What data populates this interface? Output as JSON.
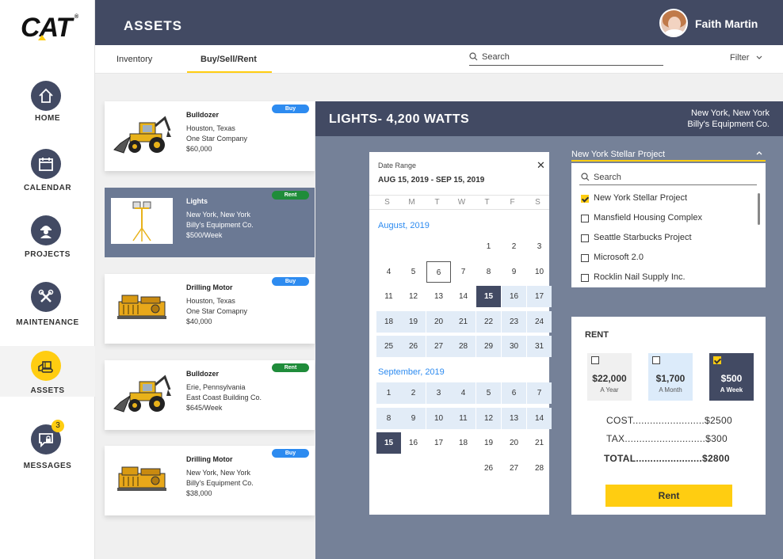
{
  "brand": {
    "logo": "CAT",
    "registered": "®",
    "accent": "#ffcd11",
    "dark": "#424a63",
    "slate": "#758198"
  },
  "header": {
    "title": "ASSETS",
    "user_name": "Faith Martin"
  },
  "sidebar": {
    "items": [
      {
        "label": "HOME",
        "icon": "home-icon"
      },
      {
        "label": "CALENDAR",
        "icon": "calendar-icon"
      },
      {
        "label": "PROJECTS",
        "icon": "worker-icon"
      },
      {
        "label": "MAINTENANCE",
        "icon": "tools-icon"
      },
      {
        "label": "ASSETS",
        "icon": "excavator-icon",
        "active": true
      },
      {
        "label": "MESSAGES",
        "icon": "message-icon",
        "badge": "3"
      }
    ]
  },
  "tabs": {
    "items": [
      "Inventory",
      "Buy/Sell/Rent"
    ],
    "active": "Buy/Sell/Rent"
  },
  "search": {
    "placeholder": "Search"
  },
  "filter": {
    "label": "Filter"
  },
  "assets": [
    {
      "name": "Bulldozer",
      "location": "Houston, Texas",
      "company": "One Star Company",
      "price": "$60,000",
      "tag": "Buy",
      "image": "backhoe"
    },
    {
      "name": "Lights",
      "location": "New York, New York",
      "company": "Billy's Equipment Co.",
      "price": "$500/Week",
      "tag": "Rent",
      "image": "lights",
      "selected": true
    },
    {
      "name": "Drilling Motor",
      "location": "Houston, Texas",
      "company": "One Star Comapny",
      "price": "$40,000",
      "tag": "Buy",
      "image": "generator"
    },
    {
      "name": "Bulldozer",
      "location": "Erie, Pennsylvania",
      "company": "East Coast Building Co.",
      "price": "$645/Week",
      "tag": "Rent",
      "image": "backhoe"
    },
    {
      "name": "Drilling Motor",
      "location": "New York, New York",
      "company": "Billy's Equipment Co.",
      "price": "$38,000",
      "tag": "Buy",
      "image": "generator"
    }
  ],
  "detail": {
    "title": "LIGHTS- 4,200 WATTS",
    "location": "New York, New York",
    "company": "Billy's Equipment Co."
  },
  "calendar": {
    "label": "Date Range",
    "range": "AUG 15, 2019 - SEP 15, 2019",
    "weekdays": [
      "S",
      "M",
      "T",
      "W",
      "T",
      "F",
      "S"
    ],
    "months": [
      {
        "name": "August, 2019",
        "weeks": [
          [
            "",
            "",
            "",
            "",
            "1",
            "2",
            "3"
          ],
          [
            "4",
            "5",
            "6",
            "7",
            "8",
            "9",
            "10"
          ],
          [
            "11",
            "12",
            "13",
            "14",
            "15",
            "16",
            "17"
          ],
          [
            "18",
            "19",
            "20",
            "21",
            "22",
            "23",
            "24"
          ],
          [
            "25",
            "26",
            "27",
            "28",
            "29",
            "30",
            "31"
          ]
        ]
      },
      {
        "name": "September, 2019",
        "weeks": [
          [
            "1",
            "2",
            "3",
            "4",
            "5",
            "6",
            "7"
          ],
          [
            "8",
            "9",
            "10",
            "11",
            "12",
            "13",
            "14"
          ],
          [
            "15",
            "16",
            "17",
            "18",
            "19",
            "20",
            "21"
          ],
          [
            "",
            "",
            "",
            "",
            "26",
            "27",
            "28"
          ]
        ]
      }
    ]
  },
  "projects": {
    "selected": "New York Stellar Project",
    "search_placeholder": "Search",
    "items": [
      {
        "label": "New York Stellar Project",
        "checked": true
      },
      {
        "label": "Mansfield Housing Complex",
        "checked": false
      },
      {
        "label": "Seattle Starbucks Project",
        "checked": false
      },
      {
        "label": "Microsoft 2.0",
        "checked": false
      },
      {
        "label": "Rocklin Nail Supply Inc.",
        "checked": false
      }
    ]
  },
  "rent": {
    "title": "RENT",
    "options": [
      {
        "price": "$22,000",
        "period": "A Year",
        "checked": false,
        "bg": "#f0f0f0"
      },
      {
        "price": "$1,700",
        "period": "A Month",
        "checked": false,
        "bg": "#dcebfa"
      },
      {
        "price": "$500",
        "period": "A Week",
        "checked": true,
        "bg": "#424a63"
      }
    ],
    "cost": "COST.........................$2500",
    "tax": "TAX............................$300",
    "total": "TOTAL.......................$2800",
    "button": "Rent"
  }
}
